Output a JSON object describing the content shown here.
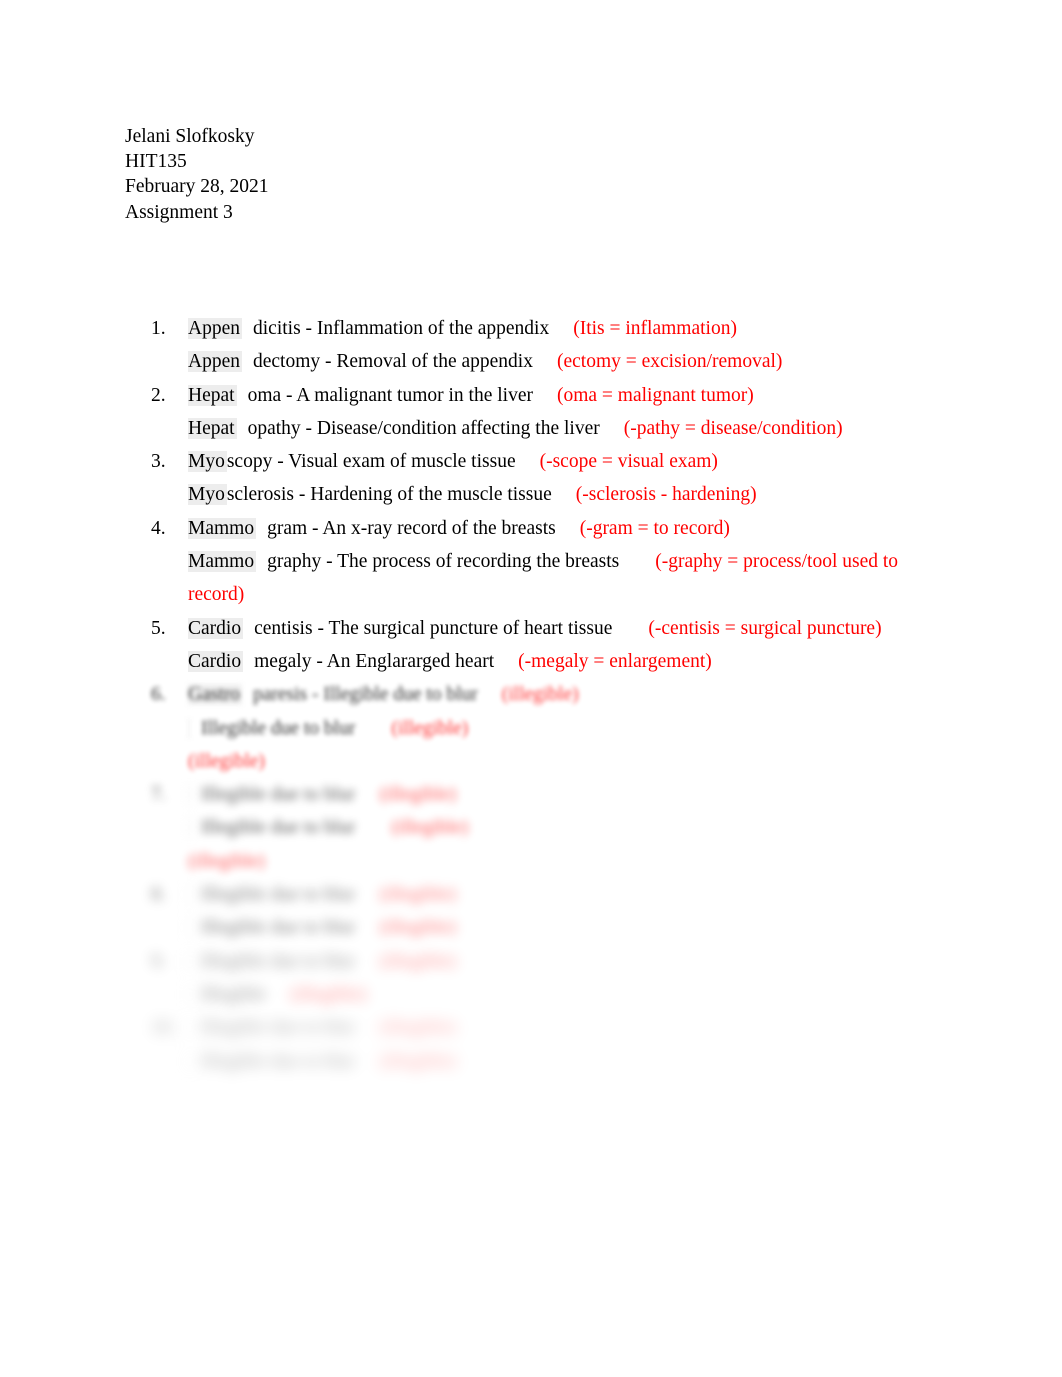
{
  "document": {
    "background_color": "#ffffff",
    "text_color": "#000000",
    "accent_color": "#ff0000",
    "prefix_highlight_color": "#ededed"
  },
  "header": {
    "author": "Jelani Slofkosky",
    "course": "HIT135",
    "date": "February 28, 2021",
    "assignment": "Assignment 3"
  },
  "list": {
    "items": [
      {
        "number": "1.",
        "legible": true,
        "lines": [
          {
            "prefix": "Appen",
            "suffix": "dicitis",
            "definition": " - Inflammation of the appendix",
            "annotation": "(Itis = inflammation)"
          },
          {
            "prefix": "Appen",
            "suffix": "dectomy",
            "definition": " - Removal of the appendix",
            "annotation": "(ectomy = excision/removal)"
          }
        ]
      },
      {
        "number": "2.",
        "legible": true,
        "lines": [
          {
            "prefix": "Hepat",
            "suffix": "oma",
            "definition": " - A malignant tumor in the liver",
            "annotation": "(oma = malignant tumor)"
          },
          {
            "prefix": "Hepat",
            "suffix": "opathy",
            "definition": " - Disease/condition affecting the liver",
            "annotation": "(-pathy = disease/condition)"
          }
        ]
      },
      {
        "number": "3.",
        "legible": true,
        "lines": [
          {
            "prefix": "Myo",
            "suffix": "scopy",
            "definition": " - Visual exam of muscle tissue",
            "annotation": "(-scope = visual exam)"
          },
          {
            "prefix": "Myo",
            "suffix": "sclerosis",
            "definition": " - Hardening of the muscle tissue",
            "annotation": "(-sclerosis - hardening)"
          }
        ]
      },
      {
        "number": "4.",
        "legible": true,
        "lines": [
          {
            "prefix": "Mammo",
            "suffix": "gram",
            "definition": " - An x-ray record of the breasts",
            "annotation": "(-gram = to record)"
          },
          {
            "prefix": "Mammo",
            "suffix": "graphy",
            "definition": " - The process of recording the breasts",
            "annotation": "(-graphy = process/tool used to",
            "annotation_wrap": "record)"
          }
        ]
      },
      {
        "number": "5.",
        "legible": true,
        "lines": [
          {
            "prefix": "Cardio",
            "suffix": "centisis",
            "definition": " - The surgical puncture of heart tissue",
            "annotation": "(-centisis = surgical puncture)"
          },
          {
            "prefix": "Cardio",
            "suffix": "megaly",
            "definition": " - An Englararged heart",
            "annotation": "(-megaly = enlargement)"
          }
        ]
      },
      {
        "number": "6.",
        "legible": false,
        "blur_level": "b1",
        "lines": [
          {
            "prefix": "Gastro",
            "suffix": "paresis",
            "definition": " - Illegible due to blur",
            "annotation": "(illegible)"
          },
          {
            "prefix": "",
            "suffix": "",
            "definition": "Illegible due to blur",
            "annotation": "(illegible)",
            "annotation_wrap": "(illegible)"
          }
        ]
      },
      {
        "number": "7.",
        "legible": false,
        "blur_level": "b2",
        "lines": [
          {
            "prefix": "",
            "suffix": "",
            "definition": "Illegible due to blur",
            "annotation": "(illegible)"
          },
          {
            "prefix": "",
            "suffix": "",
            "definition": "Illegible due to blur",
            "annotation": "(illegible)",
            "annotation_wrap": "(illegible)"
          }
        ]
      },
      {
        "number": "8.",
        "legible": false,
        "blur_level": "b3",
        "lines": [
          {
            "prefix": "",
            "suffix": "",
            "definition": "Illegible due to blur",
            "annotation": "(illegible)"
          },
          {
            "prefix": "",
            "suffix": "",
            "definition": "Illegible due to blur",
            "annotation": "(illegible)"
          }
        ]
      },
      {
        "number": "9.",
        "legible": false,
        "blur_level": "b4",
        "lines": [
          {
            "prefix": "",
            "suffix": "",
            "definition": "Illegible due to blur",
            "annotation": "(illegible)"
          },
          {
            "prefix": "",
            "suffix": "",
            "definition": "Illegible",
            "annotation": "(illegible)"
          }
        ]
      },
      {
        "number": "10.",
        "legible": false,
        "blur_level": "b5",
        "lines": [
          {
            "prefix": "",
            "suffix": "",
            "definition": "Illegible due to blur",
            "annotation": "(illegible)"
          },
          {
            "prefix": "",
            "suffix": "",
            "definition": "Illegible due to blur",
            "annotation": "(illegible)"
          }
        ]
      }
    ]
  }
}
